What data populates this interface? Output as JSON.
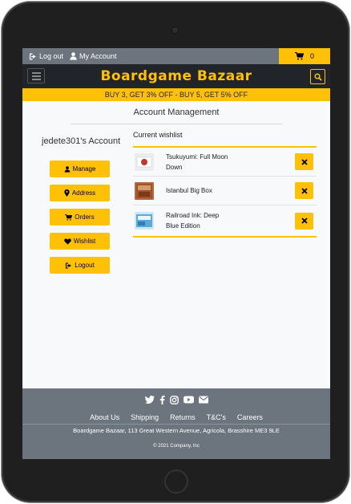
{
  "topbar": {
    "logout_label": "Log out",
    "account_label": "My Account",
    "cart_count": "0"
  },
  "header": {
    "brand": "Boardgame Bazaar"
  },
  "promo": {
    "text": "BUY 3, GET 3% OFF - BUY 5, GET 5% OFF"
  },
  "main": {
    "page_title": "Account Management",
    "account_name": "jedete301's Account",
    "buttons": [
      {
        "label": "Manage",
        "icon": "user-icon"
      },
      {
        "label": "Address",
        "icon": "map-marker-icon"
      },
      {
        "label": "Orders",
        "icon": "cart-icon"
      },
      {
        "label": "Wishlist",
        "icon": "heart-icon"
      },
      {
        "label": "Logout",
        "icon": "sign-out-icon"
      }
    ],
    "wishlist_title": "Current wishlist",
    "wishlist": [
      {
        "name": "Tsukuyumi: Full Moon Down",
        "thumb_color": "#e9e9e9"
      },
      {
        "name": "Istanbul Big Box",
        "thumb_color": "#b5683e"
      },
      {
        "name": "Railroad Ink: Deep Blue Edition",
        "thumb_color": "#5aa9d6"
      }
    ]
  },
  "footer": {
    "social": [
      "twitter-icon",
      "facebook-icon",
      "instagram-icon",
      "youtube-icon",
      "envelope-icon"
    ],
    "links": [
      "About Us",
      "Shipping",
      "Returns",
      "T&C's",
      "Careers"
    ],
    "address": "Boardgame Bazaar, 113 Great Western Avenue, Agricola, Brasshire ME3 9LE",
    "copyright": "© 2021 Company, Inc"
  },
  "colors": {
    "accent": "#ffc107",
    "dark": "#212529",
    "grey": "#6c757d"
  }
}
